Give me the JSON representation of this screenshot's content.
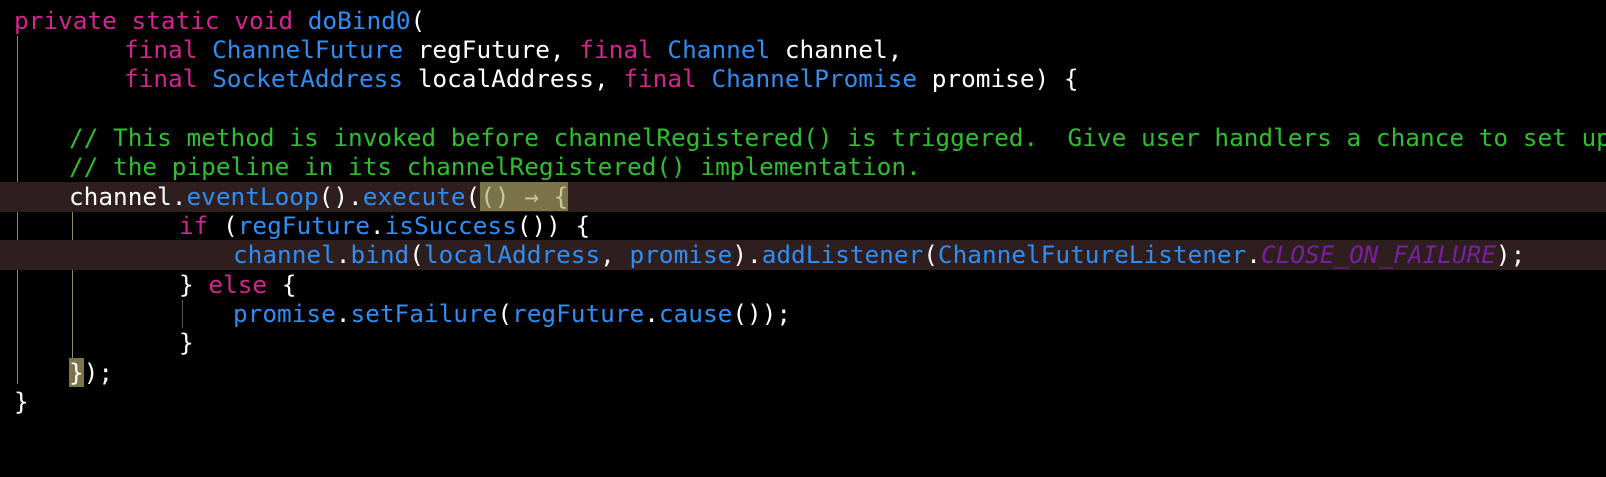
{
  "code": {
    "lines": [
      {
        "kw1": "private",
        "kw2": "static",
        "kw3": "void",
        "fn": "doBind0",
        "rest": "("
      },
      {
        "kw": "final",
        "type": "ChannelFuture",
        "ident": "regFuture",
        "sep": ", ",
        "kw2": "final",
        "type2": "Channel",
        "ident2": "channel",
        "end": ","
      },
      {
        "kw": "final",
        "type": "SocketAddress",
        "ident": "localAddress",
        "sep": ", ",
        "kw2": "final",
        "type2": "ChannelPromise",
        "ident2": "promise",
        "end": ") {"
      },
      {
        "text": ""
      },
      {
        "comment": "// This method is invoked before channelRegistered() is triggered.  Give user handlers a chance to set up"
      },
      {
        "comment": "// the pipeline in its channelRegistered() implementation."
      },
      {
        "obj": "channel",
        "dot": ".",
        "m1": "eventLoop",
        "p1": "().",
        "m2": "execute",
        "p2": "(",
        "lambda": "() → {"
      },
      {
        "kw": "if",
        "p1": " (",
        "obj": "regFuture",
        "dot": ".",
        "m": "isSuccess",
        "p2": "()) {"
      },
      {
        "obj": "channel",
        "dot": ".",
        "m1": "bind",
        "p1": "(",
        "a1": "localAddress",
        "sep": ", ",
        "a2": "promise",
        "p2": ").",
        "m2": "addListener",
        "p3": "(",
        "cls": "ChannelFutureListener",
        "dot2": ".",
        "const": "CLOSE_ON_FAILURE",
        "end": ");"
      },
      {
        "p1": "} ",
        "kw": "else",
        "p2": " {"
      },
      {
        "obj": "promise",
        "dot": ".",
        "m1": "setFailure",
        "p1": "(",
        "a1": "regFuture",
        "dot2": ".",
        "m2": "cause",
        "p2": "());"
      },
      {
        "text": "}"
      },
      {
        "brace": "}",
        "rest": ");"
      },
      {
        "text": "}"
      }
    ]
  },
  "colors": {
    "keyword": "#d1258f",
    "type": "#2f8df3",
    "comment": "#2fbe2f",
    "constant": "#7a1fa2",
    "background": "#000000",
    "line_highlight": "#2e1e1e",
    "bracket_match": "#7a7448"
  }
}
